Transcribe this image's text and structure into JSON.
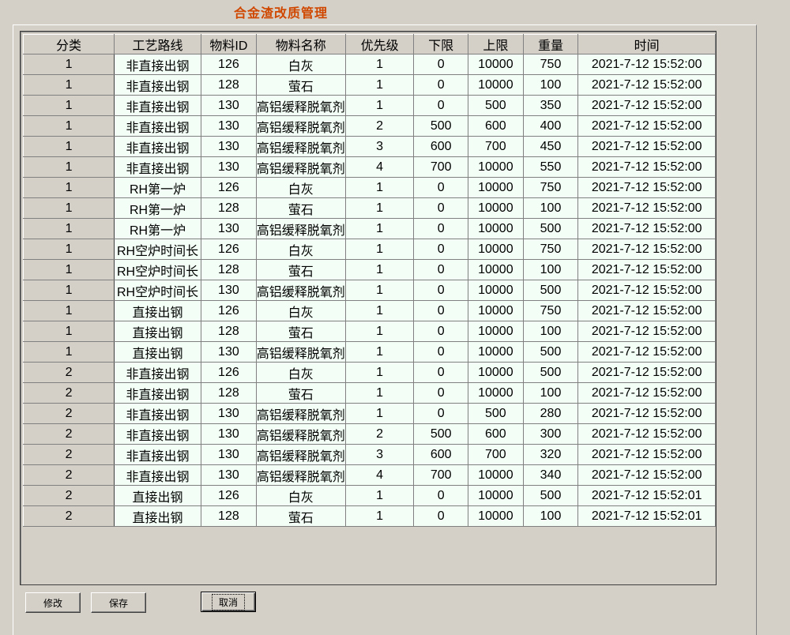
{
  "title": "合金渣改质管理",
  "columns": [
    "分类",
    "工艺路线",
    "物料ID",
    "物料名称",
    "优先级",
    "下限",
    "上限",
    "重量",
    "时间"
  ],
  "rows": [
    [
      "1",
      "非直接出钢",
      "126",
      "白灰",
      "1",
      "0",
      "10000",
      "750",
      "2021-7-12 15:52:00"
    ],
    [
      "1",
      "非直接出钢",
      "128",
      "萤石",
      "1",
      "0",
      "10000",
      "100",
      "2021-7-12 15:52:00"
    ],
    [
      "1",
      "非直接出钢",
      "130",
      "高铝缓释脱氧剂",
      "1",
      "0",
      "500",
      "350",
      "2021-7-12 15:52:00"
    ],
    [
      "1",
      "非直接出钢",
      "130",
      "高铝缓释脱氧剂",
      "2",
      "500",
      "600",
      "400",
      "2021-7-12 15:52:00"
    ],
    [
      "1",
      "非直接出钢",
      "130",
      "高铝缓释脱氧剂",
      "3",
      "600",
      "700",
      "450",
      "2021-7-12 15:52:00"
    ],
    [
      "1",
      "非直接出钢",
      "130",
      "高铝缓释脱氧剂",
      "4",
      "700",
      "10000",
      "550",
      "2021-7-12 15:52:00"
    ],
    [
      "1",
      "RH第一炉",
      "126",
      "白灰",
      "1",
      "0",
      "10000",
      "750",
      "2021-7-12 15:52:00"
    ],
    [
      "1",
      "RH第一炉",
      "128",
      "萤石",
      "1",
      "0",
      "10000",
      "100",
      "2021-7-12 15:52:00"
    ],
    [
      "1",
      "RH第一炉",
      "130",
      "高铝缓释脱氧剂",
      "1",
      "0",
      "10000",
      "500",
      "2021-7-12 15:52:00"
    ],
    [
      "1",
      "RH空炉时间长",
      "126",
      "白灰",
      "1",
      "0",
      "10000",
      "750",
      "2021-7-12 15:52:00"
    ],
    [
      "1",
      "RH空炉时间长",
      "128",
      "萤石",
      "1",
      "0",
      "10000",
      "100",
      "2021-7-12 15:52:00"
    ],
    [
      "1",
      "RH空炉时间长",
      "130",
      "高铝缓释脱氧剂",
      "1",
      "0",
      "10000",
      "500",
      "2021-7-12 15:52:00"
    ],
    [
      "1",
      "直接出钢",
      "126",
      "白灰",
      "1",
      "0",
      "10000",
      "750",
      "2021-7-12 15:52:00"
    ],
    [
      "1",
      "直接出钢",
      "128",
      "萤石",
      "1",
      "0",
      "10000",
      "100",
      "2021-7-12 15:52:00"
    ],
    [
      "1",
      "直接出钢",
      "130",
      "高铝缓释脱氧剂",
      "1",
      "0",
      "10000",
      "500",
      "2021-7-12 15:52:00"
    ],
    [
      "2",
      "非直接出钢",
      "126",
      "白灰",
      "1",
      "0",
      "10000",
      "500",
      "2021-7-12 15:52:00"
    ],
    [
      "2",
      "非直接出钢",
      "128",
      "萤石",
      "1",
      "0",
      "10000",
      "100",
      "2021-7-12 15:52:00"
    ],
    [
      "2",
      "非直接出钢",
      "130",
      "高铝缓释脱氧剂",
      "1",
      "0",
      "500",
      "280",
      "2021-7-12 15:52:00"
    ],
    [
      "2",
      "非直接出钢",
      "130",
      "高铝缓释脱氧剂",
      "2",
      "500",
      "600",
      "300",
      "2021-7-12 15:52:00"
    ],
    [
      "2",
      "非直接出钢",
      "130",
      "高铝缓释脱氧剂",
      "3",
      "600",
      "700",
      "320",
      "2021-7-12 15:52:00"
    ],
    [
      "2",
      "非直接出钢",
      "130",
      "高铝缓释脱氧剂",
      "4",
      "700",
      "10000",
      "340",
      "2021-7-12 15:52:00"
    ],
    [
      "2",
      "直接出钢",
      "126",
      "白灰",
      "1",
      "0",
      "10000",
      "500",
      "2021-7-12 15:52:01"
    ],
    [
      "2",
      "直接出钢",
      "128",
      "萤石",
      "1",
      "0",
      "10000",
      "100",
      "2021-7-12 15:52:01"
    ]
  ],
  "buttons": {
    "modify": "修改",
    "save": "保存",
    "cancel": "取消"
  }
}
